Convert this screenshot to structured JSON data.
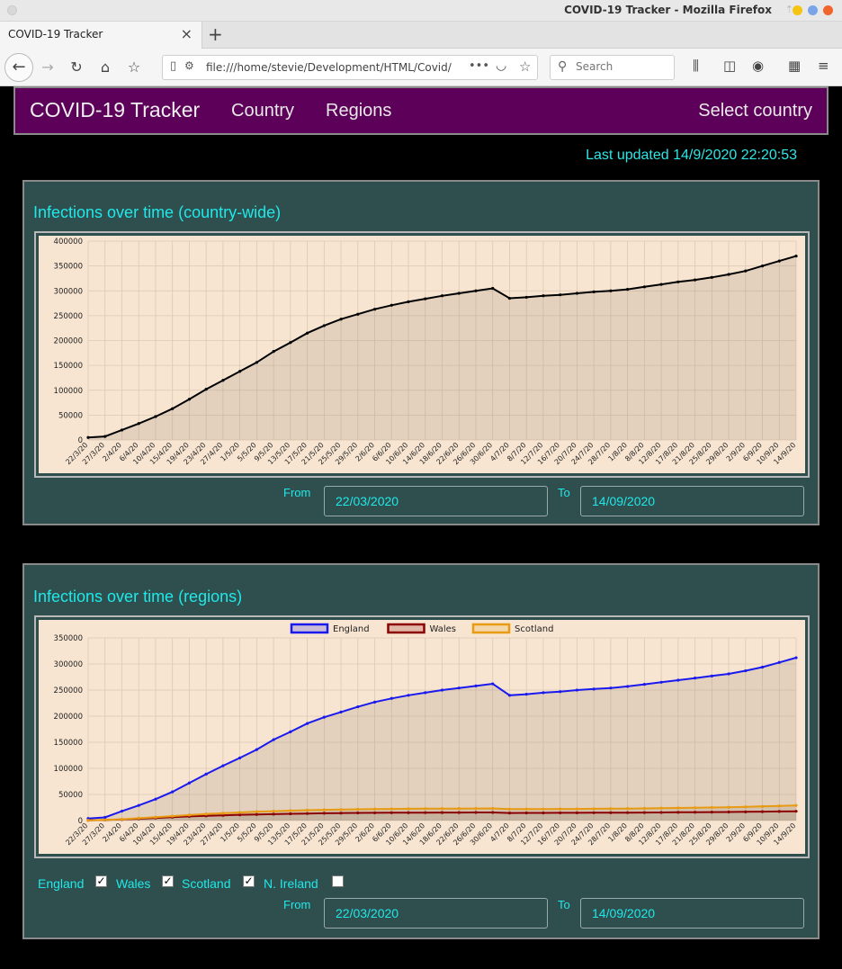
{
  "browser": {
    "window_title": "COVID-19 Tracker - Mozilla Firefox",
    "tab_title": "COVID-19 Tracker",
    "url": "file:///home/stevie/Development/HTML/Covid/",
    "search_placeholder": "Search"
  },
  "nav": {
    "brand": "COVID-19 Tracker",
    "links": [
      "Country",
      "Regions"
    ],
    "select_country": "Select country"
  },
  "last_updated": "Last updated 14/9/2020 22:20:53",
  "country_card": {
    "title": "Infections over time (country-wide)",
    "from_label": "From",
    "to_label": "To",
    "from_value": "22/03/2020",
    "to_value": "14/09/2020"
  },
  "regions_card": {
    "title": "Infections over time (regions)",
    "from_label": "From",
    "to_label": "To",
    "from_value": "22/03/2020",
    "to_value": "14/09/2020",
    "toggles": [
      {
        "label": "England",
        "checked": true
      },
      {
        "label": "Wales",
        "checked": true
      },
      {
        "label": "Scotland",
        "checked": true
      },
      {
        "label": "N. Ireland",
        "checked": false
      }
    ]
  },
  "chart_data": [
    {
      "type": "area",
      "ylim": [
        0,
        400000
      ],
      "yticks": [
        0,
        50000,
        100000,
        150000,
        200000,
        250000,
        300000,
        350000,
        400000
      ],
      "x_tick_labels": [
        "22/3/20",
        "27/3/20",
        "2/4/20",
        "6/4/20",
        "10/4/20",
        "15/4/20",
        "19/4/20",
        "23/4/20",
        "27/4/20",
        "1/5/20",
        "5/5/20",
        "9/5/20",
        "13/5/20",
        "17/5/20",
        "21/5/20",
        "25/5/20",
        "29/5/20",
        "2/6/20",
        "6/6/20",
        "10/6/20",
        "14/6/20",
        "18/6/20",
        "22/6/20",
        "26/6/20",
        "30/6/20",
        "4/7/20",
        "8/7/20",
        "12/7/20",
        "16/7/20",
        "20/7/20",
        "24/7/20",
        "28/7/20",
        "1/8/20",
        "8/8/20",
        "12/8/20",
        "17/8/20",
        "21/8/20",
        "25/8/20",
        "29/8/20",
        "2/9/20",
        "6/9/20",
        "10/9/20",
        "14/9/20"
      ],
      "grid": true,
      "series": [
        {
          "color": "#000000",
          "values": [
            5000,
            7000,
            20000,
            33000,
            47000,
            63000,
            82000,
            102000,
            120000,
            138000,
            156000,
            178000,
            196000,
            215000,
            230000,
            243000,
            253000,
            263000,
            271000,
            278000,
            284000,
            290000,
            295000,
            300000,
            305000,
            285000,
            287000,
            290000,
            292000,
            295000,
            298000,
            300000,
            303000,
            308000,
            313000,
            318000,
            322000,
            327000,
            333000,
            340000,
            350000,
            360000,
            370000
          ]
        }
      ]
    },
    {
      "type": "area",
      "ylim": [
        0,
        350000
      ],
      "yticks": [
        0,
        50000,
        100000,
        150000,
        200000,
        250000,
        300000,
        350000
      ],
      "x_tick_labels": [
        "22/3/20",
        "27/3/20",
        "2/4/20",
        "6/4/20",
        "10/4/20",
        "15/4/20",
        "19/4/20",
        "23/4/20",
        "27/4/20",
        "1/5/20",
        "5/5/20",
        "9/5/20",
        "13/5/20",
        "17/5/20",
        "21/5/20",
        "25/5/20",
        "29/5/20",
        "2/6/20",
        "6/6/20",
        "10/6/20",
        "14/6/20",
        "18/6/20",
        "22/6/20",
        "26/6/20",
        "30/6/20",
        "4/7/20",
        "8/7/20",
        "12/7/20",
        "16/7/20",
        "20/7/20",
        "24/7/20",
        "28/7/20",
        "1/8/20",
        "8/8/20",
        "12/8/20",
        "17/8/20",
        "21/8/20",
        "25/8/20",
        "29/8/20",
        "2/9/20",
        "6/9/20",
        "10/9/20",
        "14/9/20"
      ],
      "legend": "top",
      "grid": true,
      "series": [
        {
          "name": "England",
          "color": "#1a1aee",
          "values": [
            4000,
            6000,
            18000,
            29000,
            41000,
            55000,
            72000,
            89000,
            105000,
            120000,
            136000,
            155000,
            170000,
            186000,
            198000,
            208000,
            218000,
            227000,
            234000,
            240000,
            245000,
            250000,
            254000,
            258000,
            262000,
            240000,
            242000,
            245000,
            247000,
            250000,
            252000,
            254000,
            257000,
            261000,
            265000,
            269000,
            273000,
            277000,
            281000,
            287000,
            294000,
            303000,
            312000
          ]
        },
        {
          "name": "Wales",
          "color": "#8b0000",
          "values": [
            500,
            1000,
            2000,
            3500,
            5000,
            6500,
            8000,
            9000,
            10000,
            11000,
            11700,
            12300,
            13000,
            13500,
            14000,
            14300,
            14600,
            14800,
            15000,
            15100,
            15200,
            15300,
            15400,
            15500,
            15600,
            14500,
            14600,
            14700,
            14800,
            14900,
            15000,
            15100,
            15200,
            15400,
            15600,
            15800,
            16000,
            16200,
            16400,
            16700,
            17000,
            17400,
            17800
          ]
        },
        {
          "name": "Scotland",
          "color": "#e89a10",
          "values": [
            500,
            1200,
            2500,
            4500,
            6500,
            8500,
            10500,
            12500,
            14000,
            15500,
            17000,
            18000,
            19000,
            19800,
            20500,
            21000,
            21500,
            22000,
            22300,
            22500,
            22700,
            22900,
            23000,
            23100,
            23200,
            21900,
            22000,
            22100,
            22200,
            22300,
            22500,
            22700,
            23000,
            23300,
            23700,
            24100,
            24500,
            25000,
            25500,
            26200,
            27000,
            28000,
            29000
          ]
        }
      ]
    }
  ]
}
